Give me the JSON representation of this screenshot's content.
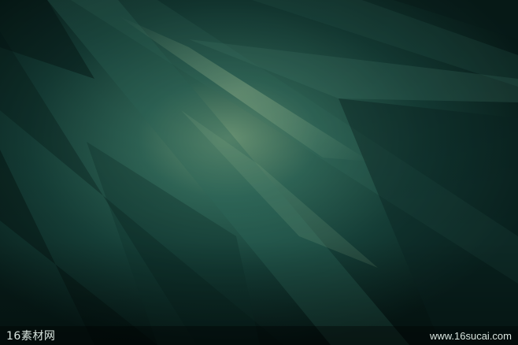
{
  "watermark": {
    "logo_text": "16素材网",
    "url_text": "www.16sucai.com"
  },
  "colors": {
    "base": "#0b2a26",
    "mid": "#1d4a42",
    "highlight": "#8fb58f",
    "shadow": "#061917"
  }
}
